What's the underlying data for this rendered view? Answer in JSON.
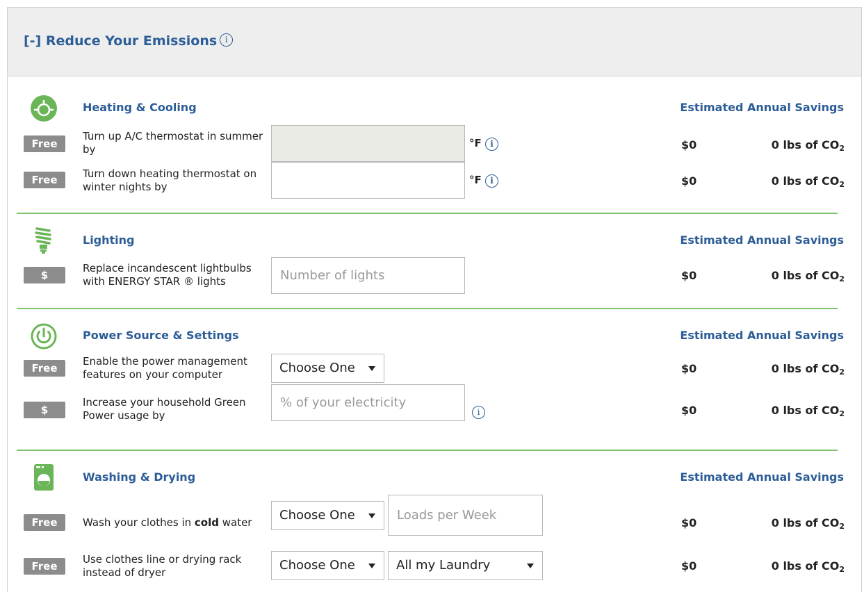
{
  "header": {
    "title": "[-] Reduce Your Emissions",
    "info_icon": "info-icon"
  },
  "colors": {
    "accent_blue": "#2c5d96",
    "divider_green": "#7cc16b",
    "icon_green": "#6ab557",
    "badge_gray": "#8c8c8c"
  },
  "savings_header": "Estimated Annual Savings",
  "categories": [
    {
      "title": "Heating & Cooling",
      "icon": "thermostat-icon",
      "rows": [
        {
          "badge": "Free",
          "label": "Turn up A/C thermostat in summer by",
          "input_placeholder": "",
          "unit": "°F",
          "money": "$0",
          "co2_prefix": "0 lbs of CO",
          "co2_sub": "2"
        },
        {
          "badge": "Free",
          "label": "Turn down heating thermostat on winter nights by",
          "input_placeholder": "",
          "unit": "°F",
          "money": "$0",
          "co2_prefix": "0 lbs of CO",
          "co2_sub": "2"
        }
      ]
    },
    {
      "title": "Lighting",
      "icon": "lightbulb-icon",
      "rows": [
        {
          "badge": "$",
          "label": "Replace incandescent lightbulbs with ENERGY STAR ® lights",
          "input_placeholder": "Number of lights",
          "money": "$0",
          "co2_prefix": "0 lbs of CO",
          "co2_sub": "2"
        }
      ]
    },
    {
      "title": "Power Source & Settings",
      "icon": "power-icon",
      "rows": [
        {
          "badge": "Free",
          "label": "Enable the power management features on your computer",
          "select_value": "Choose One",
          "money": "$0",
          "co2_prefix": "0 lbs of CO",
          "co2_sub": "2"
        },
        {
          "badge": "$",
          "label": "Increase your household Green Power usage by",
          "input_placeholder": "% of your electricity",
          "money": "$0",
          "co2_prefix": "0 lbs of CO",
          "co2_sub": "2"
        }
      ]
    },
    {
      "title": "Washing & Drying",
      "icon": "washing-machine-icon",
      "rows": [
        {
          "badge": "Free",
          "label_pre": "Wash your clothes in ",
          "label_bold": "cold",
          "label_post": " water",
          "select_value": "Choose One",
          "input_placeholder": "Loads per Week",
          "money": "$0",
          "co2_prefix": "0 lbs of CO",
          "co2_sub": "2"
        },
        {
          "badge": "Free",
          "label": "Use clothes line or drying rack instead of dryer",
          "select_value": "Choose One",
          "select2_value": "All my Laundry",
          "money": "$0",
          "co2_prefix": "0 lbs of CO",
          "co2_sub": "2"
        }
      ]
    }
  ]
}
